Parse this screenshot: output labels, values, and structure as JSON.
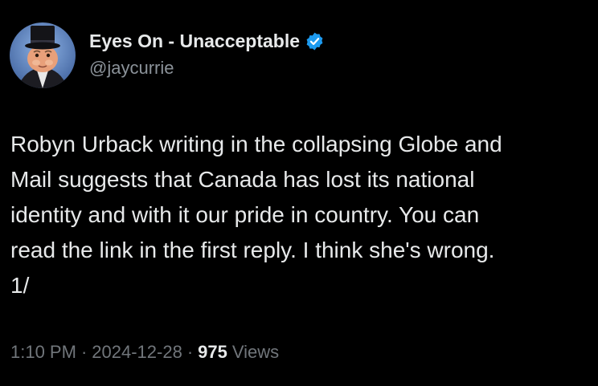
{
  "author": {
    "display_name": "Eyes On - Unacceptable",
    "handle": "@jaycurrie",
    "verified": true,
    "avatar_icon": "top-hat-character-avatar"
  },
  "tweet": {
    "text": "Robyn Urback writing in the collapsing Globe and\nMail suggests that Canada has lost its national\nidentity and with it our pride in country. You can\nread the link in the first reply. I think she's wrong.\n1/"
  },
  "meta": {
    "time": "1:10 PM",
    "separator": "·",
    "date": "2024-12-28",
    "views_count": "975",
    "views_label": "Views"
  },
  "colors": {
    "background": "#000000",
    "primary_text": "#e7e9ea",
    "secondary_text": "#71767b",
    "verified_badge": "#1d9bf0"
  }
}
